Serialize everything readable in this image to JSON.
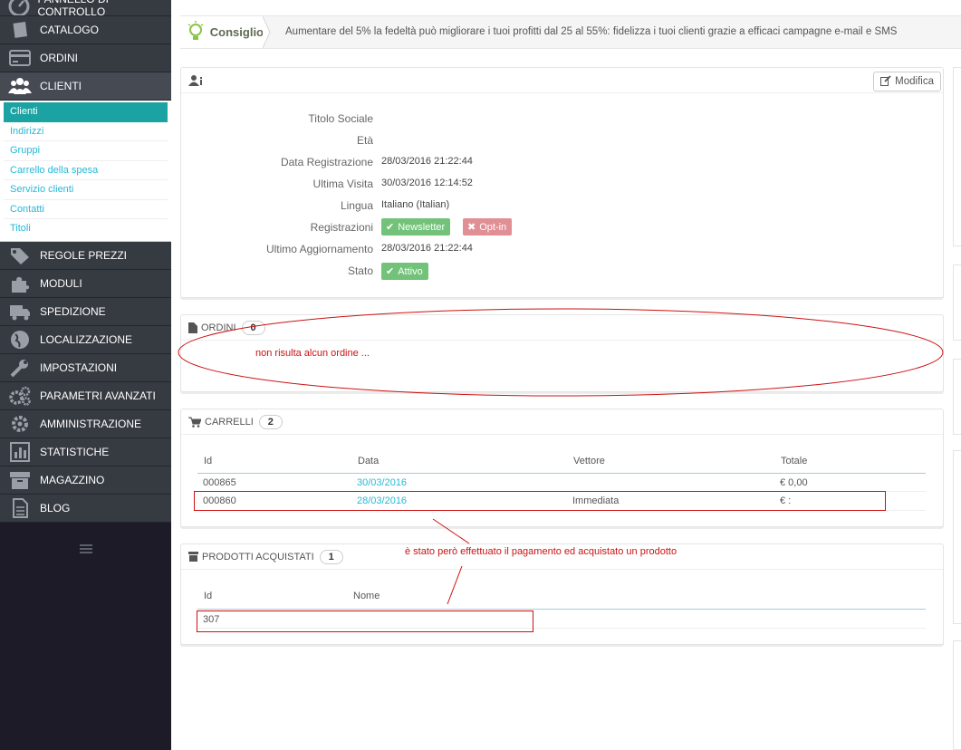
{
  "sidebar": {
    "items": [
      {
        "label": "PANNELLO DI CONTROLLO",
        "icon": "dashboard-icon"
      },
      {
        "label": "CATALOGO",
        "icon": "book-icon"
      },
      {
        "label": "ORDINI",
        "icon": "credit-card-icon"
      },
      {
        "label": "CLIENTI",
        "icon": "users-icon"
      },
      {
        "label": "REGOLE PREZZI",
        "icon": "tags-icon"
      },
      {
        "label": "MODULI",
        "icon": "puzzle-icon"
      },
      {
        "label": "SPEDIZIONE",
        "icon": "truck-icon"
      },
      {
        "label": "LOCALIZZAZIONE",
        "icon": "globe-icon"
      },
      {
        "label": "IMPOSTAZIONI",
        "icon": "wrench-icon"
      },
      {
        "label": "PARAMETRI AVANZATI",
        "icon": "cogs-icon"
      },
      {
        "label": "AMMINISTRAZIONE",
        "icon": "cog-icon"
      },
      {
        "label": "STATISTICHE",
        "icon": "bar-chart-icon"
      },
      {
        "label": "MAGAZZINO",
        "icon": "archive-icon"
      },
      {
        "label": "BLOG",
        "icon": "document-icon"
      }
    ],
    "submenu": [
      "Clienti",
      "Indirizzi",
      "Gruppi",
      "Carrello della spesa",
      "Servizio clienti",
      "Contatti",
      "Titoli"
    ],
    "active_item": "CLIENTI",
    "active_sub": "Clienti"
  },
  "tip": {
    "label": "Consiglio",
    "text": "Aumentare del 5% la fedeltà può migliorare i tuoi profitti dal 25 al 55%: fidelizza i tuoi clienti grazie a efficaci campagne e-mail e SMS"
  },
  "customer": {
    "edit_label": "Modifica",
    "rows": [
      {
        "key": "Titolo Sociale",
        "value": ""
      },
      {
        "key": "Età",
        "value": ""
      },
      {
        "key": "Data Registrazione",
        "value": "28/03/2016 21:22:44"
      },
      {
        "key": "Ultima Visita",
        "value": "30/03/2016 12:14:52"
      },
      {
        "key": "Lingua",
        "value": "Italiano (Italian)"
      },
      {
        "key": "Registrazioni",
        "value": ""
      },
      {
        "key": "Ultimo Aggiornamento",
        "value": "28/03/2016 21:22:44"
      },
      {
        "key": "Stato",
        "value": ""
      }
    ],
    "newsletter_label": "Newsletter",
    "optin_label": "Opt-in",
    "status_label": "Attivo"
  },
  "orders": {
    "title": "ORDINI",
    "count": "0",
    "annotation": "non risulta alcun ordine ..."
  },
  "carts": {
    "title": "CARRELLI",
    "count": "2",
    "columns": [
      "Id",
      "Data",
      "Vettore",
      "Totale"
    ],
    "rows": [
      {
        "id": "000865",
        "date": "30/03/2016",
        "carrier": "",
        "total": "€ 0,00"
      },
      {
        "id": "000860",
        "date": "28/03/2016",
        "carrier": "Immediata",
        "total": "€ :"
      }
    ]
  },
  "products": {
    "title": "PRODOTTI ACQUISTATI",
    "count": "1",
    "columns": [
      "Id",
      "Nome"
    ],
    "rows": [
      {
        "id": "307",
        "name": ""
      }
    ],
    "annotation": "è stato però effettuato il pagamento ed acquistato un prodotto"
  },
  "colors": {
    "sidebar_bg": "#363a41",
    "sidebar_dark": "#1c1b27",
    "accent": "#25b9d7",
    "active_sub": "#1ba3a3",
    "green_label": "#72c279",
    "red_label": "#e08f95",
    "annotation": "#cc1111"
  }
}
